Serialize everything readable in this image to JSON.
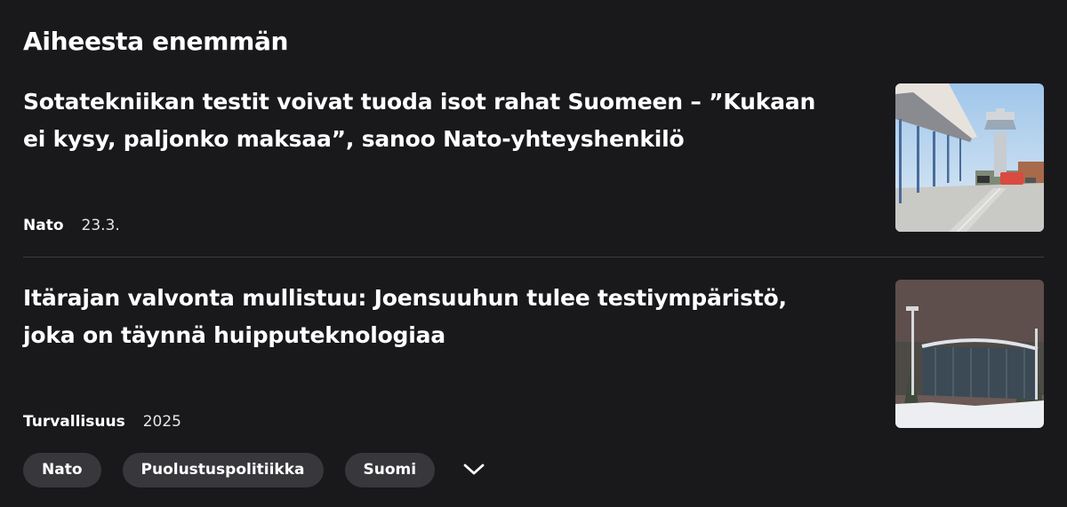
{
  "section": {
    "title": "Aiheesta enemmän"
  },
  "articles": [
    {
      "headline": "Sotatekniikan testit voivat tuoda isot rahat Suomeen – ”Kukaan ei kysy, paljonko maksaa”, sanoo Nato-yhteyshenkilö",
      "category": "Nato",
      "date": "23.3."
    },
    {
      "headline": "Itärajan valvonta mullistuu: Joensuuhun tulee testiympäristö, joka on täynnä huipputeknologiaa",
      "category": "Turvallisuus",
      "date": "2025"
    }
  ],
  "tags": [
    {
      "label": "Nato"
    },
    {
      "label": "Puolustuspolitiikka"
    },
    {
      "label": "Suomi"
    }
  ],
  "icons": {
    "expand": "chevron-down-icon"
  },
  "colors": {
    "background": "#19191c",
    "tag_bg": "#38383c",
    "divider": "#3d3d42",
    "text": "#ffffff"
  }
}
